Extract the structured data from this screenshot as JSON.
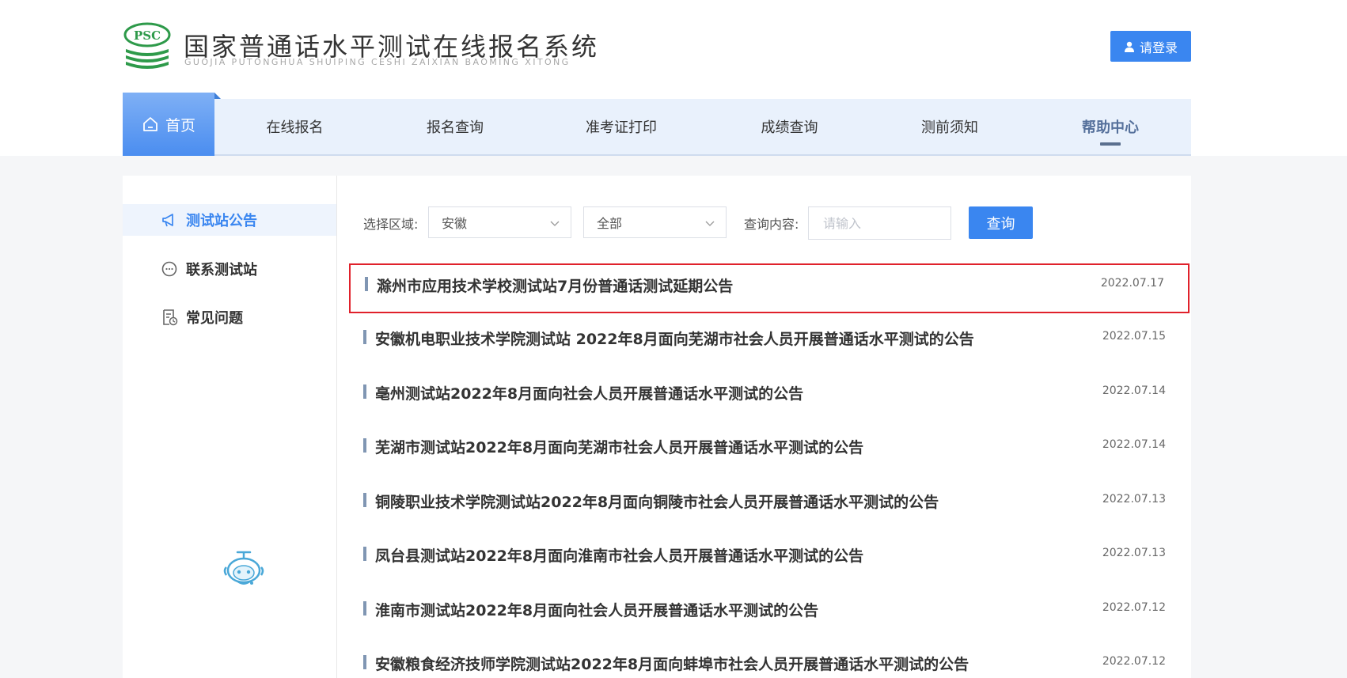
{
  "header": {
    "logo_text": "PSC",
    "title": "国家普通话水平测试在线报名系统",
    "subtitle": "GUOJIA PUTONGHUA SHUIPING CESHI ZAIXIAN BAOMING XITONG",
    "login_label": "请登录"
  },
  "nav": {
    "items": [
      {
        "label": "首页"
      },
      {
        "label": "在线报名"
      },
      {
        "label": "报名查询"
      },
      {
        "label": "准考证打印"
      },
      {
        "label": "成绩查询"
      },
      {
        "label": "测前须知"
      },
      {
        "label": "帮助中心"
      }
    ],
    "active": "帮助中心"
  },
  "sidebar": {
    "items": [
      {
        "label": "测试站公告",
        "icon": "megaphone-icon"
      },
      {
        "label": "联系测试站",
        "icon": "chat-icon"
      },
      {
        "label": "常见问题",
        "icon": "document-clock-icon"
      }
    ]
  },
  "filter": {
    "region_label": "选择区域:",
    "province_value": "安徽",
    "city_value": "全部",
    "query_label": "查询内容:",
    "query_placeholder": "请输入",
    "query_button": "查询"
  },
  "notices": [
    {
      "title": "滁州市应用技术学校测试站7月份普通话测试延期公告",
      "date": "2022.07.17",
      "highlighted": true
    },
    {
      "title": "安徽机电职业技术学院测试站 2022年8月面向芜湖市社会人员开展普通话水平测试的公告",
      "date": "2022.07.15"
    },
    {
      "title": "亳州测试站2022年8月面向社会人员开展普通话水平测试的公告",
      "date": "2022.07.14"
    },
    {
      "title": "芜湖市测试站2022年8月面向芜湖市社会人员开展普通话水平测试的公告",
      "date": "2022.07.14"
    },
    {
      "title": "铜陵职业技术学院测试站2022年8月面向铜陵市社会人员开展普通话水平测试的公告",
      "date": "2022.07.13"
    },
    {
      "title": "凤台县测试站2022年8月面向淮南市社会人员开展普通话水平测试的公告",
      "date": "2022.07.13"
    },
    {
      "title": "淮南市测试站2022年8月面向社会人员开展普通话水平测试的公告",
      "date": "2022.07.12"
    },
    {
      "title": "安徽粮食经济技师学院测试站2022年8月面向蚌埠市社会人员开展普通话水平测试的公告",
      "date": "2022.07.12"
    }
  ],
  "colors": {
    "accent": "#3a86f0",
    "highlight_border": "#e0212b",
    "nav_bg": "#e9f1fc",
    "logo_green": "#2e9a4a"
  }
}
